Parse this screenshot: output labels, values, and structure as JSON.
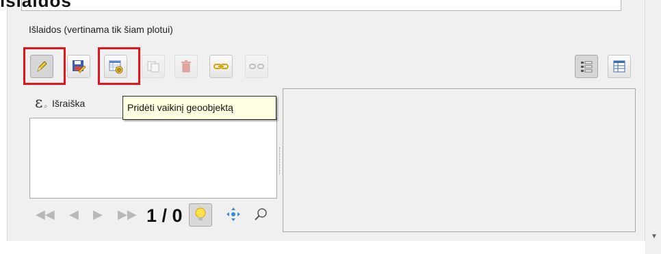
{
  "header": {
    "cut_title": "lšlaidos"
  },
  "section": {
    "label": "Išlaidos (vertinama tik šiam plotui)"
  },
  "toolbar": {
    "buttons": [
      {
        "name": "toggle-editing",
        "icon": "pencil-icon",
        "state": "pressed"
      },
      {
        "name": "save-edits",
        "icon": "save-icon",
        "state": "enabled"
      },
      {
        "name": "add-child-feature",
        "icon": "add-child-feature-icon",
        "state": "enabled"
      },
      {
        "name": "duplicate-feature",
        "icon": "duplicate-icon",
        "state": "disabled"
      },
      {
        "name": "delete-feature",
        "icon": "trash-icon",
        "state": "disabled"
      },
      {
        "name": "link-feature",
        "icon": "link-icon",
        "state": "enabled"
      },
      {
        "name": "unlink-feature",
        "icon": "unlink-icon",
        "state": "disabled"
      },
      {
        "name": "form-view",
        "icon": "form-view-icon",
        "state": "pressed"
      },
      {
        "name": "table-view",
        "icon": "table-view-icon",
        "state": "enabled"
      }
    ],
    "highlight_color": "#e3141b"
  },
  "expression": {
    "label": "Išraiška"
  },
  "tooltip": {
    "text": "Pridėti vaikinį geoobjektą"
  },
  "navigation": {
    "counter": "1 / 0"
  }
}
